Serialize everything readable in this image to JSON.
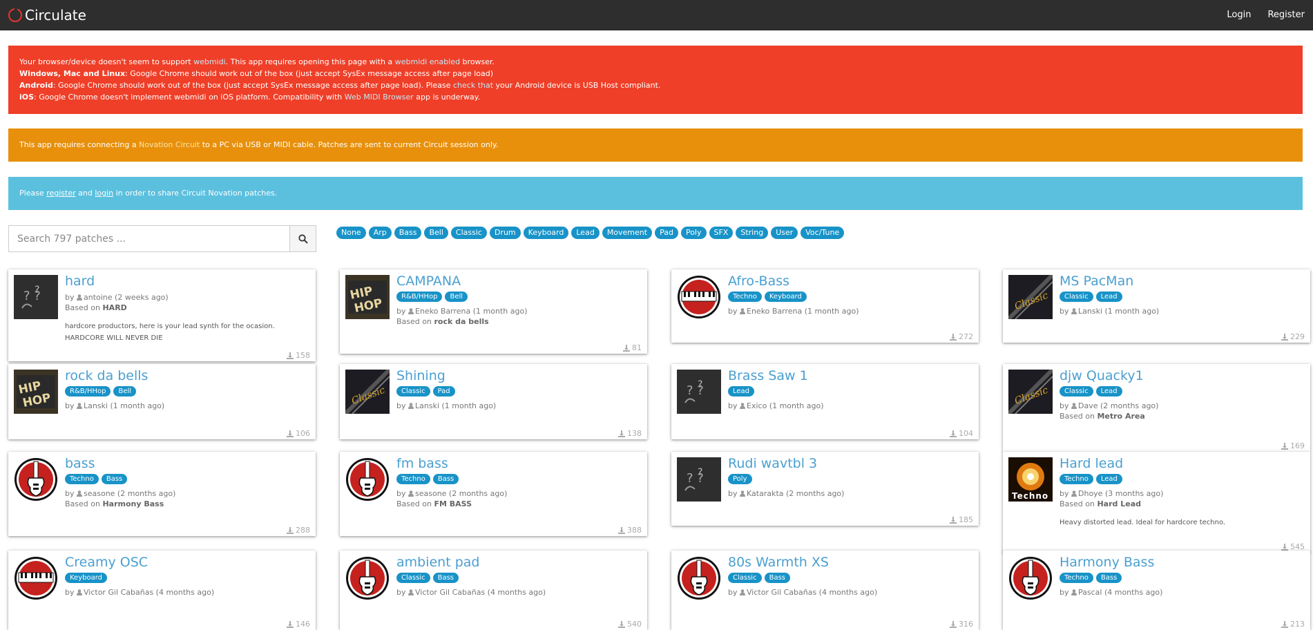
{
  "app": {
    "title": "Circulate"
  },
  "nav": {
    "login": "Login",
    "register": "Register"
  },
  "alerts": {
    "danger": {
      "l1a": "Your browser/device doesn't seem to support ",
      "l1link1": "webmidi",
      "l1b": ". This app requires opening this page with a ",
      "l1link2": "webmidi enabled",
      "l1c": " browser.",
      "l2b": "Windows, Mac and Linux",
      "l2": ": Google Chrome should work out of the box (just accept SysEx message access after page load)",
      "l3b": "Android",
      "l3a": ": Google Chrome should work out of the box (just accept SysEx message access after page load). Please ",
      "l3link": "check that",
      "l3c": " your Android device is USB Host compliant.",
      "l4b": "iOS",
      "l4a": ": Google Chrome doesn't implement webmidi on iOS platform. Compatibility with ",
      "l4link": "Web MIDI Browser",
      "l4c": " app is underway."
    },
    "warning": {
      "a": "This app requires connecting a ",
      "link": "Novation Circuit",
      "b": " to a PC via USB or MIDI cable. Patches are sent to current Circuit session only."
    },
    "info": {
      "a": "Please ",
      "register": "register",
      "b": " and ",
      "login": "login",
      "c": " in order to share Circuit Novation patches."
    }
  },
  "search": {
    "placeholder": "Search 797 patches ..."
  },
  "filter_tags": [
    "None",
    "Arp",
    "Bass",
    "Bell",
    "Classic",
    "Drum",
    "Keyboard",
    "Lead",
    "Movement",
    "Pad",
    "Poly",
    "SFX",
    "String",
    "User",
    "Voc/Tune"
  ],
  "colors": {
    "accent": "#1893c8",
    "danger": "#ef3f28",
    "warning": "#e8900c",
    "info": "#5bc0de",
    "navbar": "#2e2e2e"
  },
  "patches": [
    {
      "title": "hard",
      "tags": [],
      "by": "by",
      "author": "antoine (2 weeks ago)",
      "based_label": "Based on",
      "based": "HARD",
      "desc": "hardcore productors, here is your lead synth for the ocasion. HARDCORE WILL NEVER DIE",
      "downloads": "158",
      "thumb": "notes-icon"
    },
    {
      "title": "CAMPANA",
      "tags": [
        "R&B/HHop",
        "Bell"
      ],
      "by": "by",
      "author": "Eneko Barrena (1 month ago)",
      "based_label": "Based on",
      "based": "rock da bells",
      "desc": "",
      "downloads": "81",
      "thumb": "hiphop-icon"
    },
    {
      "title": "Afro-Bass",
      "tags": [
        "Techno",
        "Keyboard"
      ],
      "by": "by",
      "author": "Eneko Barrena (1 month ago)",
      "based_label": "",
      "based": "",
      "desc": "",
      "downloads": "272",
      "thumb": "keyboard-icon"
    },
    {
      "title": "MS PacMan",
      "tags": [
        "Classic",
        "Lead"
      ],
      "by": "by",
      "author": "Lanski (1 month ago)",
      "based_label": "",
      "based": "",
      "desc": "",
      "downloads": "229",
      "thumb": "classic-icon"
    },
    {
      "title": "rock da bells",
      "tags": [
        "R&B/HHop",
        "Bell"
      ],
      "by": "by",
      "author": "Lanski (1 month ago)",
      "based_label": "",
      "based": "",
      "desc": "",
      "downloads": "106",
      "thumb": "hiphop-icon"
    },
    {
      "title": "Shining",
      "tags": [
        "Classic",
        "Pad"
      ],
      "by": "by",
      "author": "Lanski (1 month ago)",
      "based_label": "",
      "based": "",
      "desc": "",
      "downloads": "138",
      "thumb": "classic-icon"
    },
    {
      "title": "Brass Saw 1",
      "tags": [
        "Lead"
      ],
      "by": "by",
      "author": "Exico (1 month ago)",
      "based_label": "",
      "based": "",
      "desc": "",
      "downloads": "104",
      "thumb": "notes-icon"
    },
    {
      "title": "djw Quacky1",
      "tags": [
        "Classic",
        "Lead"
      ],
      "by": "by",
      "author": "Dave (2 months ago)",
      "based_label": "Based on",
      "based": "Metro Area",
      "desc": "",
      "downloads": "169",
      "thumb": "classic-icon"
    },
    {
      "title": "bass",
      "tags": [
        "Techno",
        "Bass"
      ],
      "by": "by",
      "author": "seasone (2 months ago)",
      "based_label": "Based on",
      "based": "Harmony Bass",
      "desc": "",
      "downloads": "288",
      "thumb": "guitar-icon"
    },
    {
      "title": "fm bass",
      "tags": [
        "Techno",
        "Bass"
      ],
      "by": "by",
      "author": "seasone (2 months ago)",
      "based_label": "Based on",
      "based": "FM BASS",
      "desc": "",
      "downloads": "388",
      "thumb": "guitar-icon"
    },
    {
      "title": "Rudi wavtbl 3",
      "tags": [
        "Poly"
      ],
      "by": "by",
      "author": "Katarakta (2 months ago)",
      "based_label": "",
      "based": "",
      "desc": "",
      "downloads": "185",
      "thumb": "notes-icon"
    },
    {
      "title": "Hard lead",
      "tags": [
        "Techno",
        "Lead"
      ],
      "by": "by",
      "author": "Dhoye (3 months ago)",
      "based_label": "Based on",
      "based": "Hard Lead",
      "desc": "Heavy distorted lead. Ideal for hardcore techno.",
      "downloads": "545",
      "thumb": "techno-icon"
    },
    {
      "title": "Creamy OSC",
      "tags": [
        "Keyboard"
      ],
      "by": "by",
      "author": "Victor Gil Cabañas (4 months ago)",
      "based_label": "",
      "based": "",
      "desc": "",
      "downloads": "146",
      "thumb": "keyboard-icon"
    },
    {
      "title": "ambient pad",
      "tags": [
        "Classic",
        "Bass"
      ],
      "by": "by",
      "author": "Victor Gil Cabañas (4 months ago)",
      "based_label": "",
      "based": "",
      "desc": "",
      "downloads": "540",
      "thumb": "guitar-icon"
    },
    {
      "title": "80s Warmth XS",
      "tags": [
        "Classic",
        "Bass"
      ],
      "by": "by",
      "author": "Victor Gil Cabañas (4 months ago)",
      "based_label": "",
      "based": "",
      "desc": "",
      "downloads": "316",
      "thumb": "guitar-icon"
    },
    {
      "title": "Harmony Bass",
      "tags": [
        "Techno",
        "Bass"
      ],
      "by": "by",
      "author": "Pascal (4 months ago)",
      "based_label": "",
      "based": "",
      "desc": "",
      "downloads": "213",
      "thumb": "guitar-icon"
    }
  ]
}
